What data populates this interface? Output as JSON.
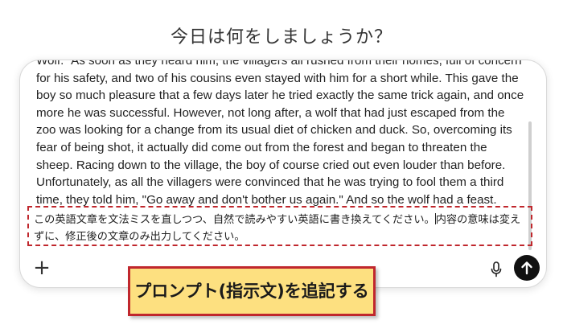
{
  "heading": "今日は何をしましょうか？",
  "composer": {
    "english_text": "Wolf.\" As soon as they heard him, the villagers all rushed from their homes, full of concern for his safety, and two of his cousins even stayed with him for a short while. This gave the boy so much pleasure that a few days later he tried exactly the same trick again, and once more he was successful. However, not long after, a wolf that had just escaped from the zoo was looking for a change from its usual diet of chicken and duck. So, overcoming its fear of being shot, it actually did come out from the forest and began to threaten the sheep. Racing down to the village, the boy of course cried out even louder than before. Unfortunately, as all the villagers were convinced that he was trying to fool them a third time, they told him, \"Go away and don't bother us again.\" And so the wolf had a feast.",
    "prompt_part1": "この英語文章を文法ミスを直しつつ、自然で読みやすい英語に書き換えてください。",
    "prompt_part2": "内容の意味は変えずに、修正後の文章のみ出力してください。",
    "plus_label": "+",
    "icons": {
      "plus": "plus-icon",
      "mic": "microphone-icon",
      "send": "arrow-up-icon"
    }
  },
  "callout": "プロンプト(指示文)を追記する",
  "colors": {
    "highlight_border": "#c0272d",
    "callout_fill": "#fde080",
    "send_button": "#111111"
  }
}
